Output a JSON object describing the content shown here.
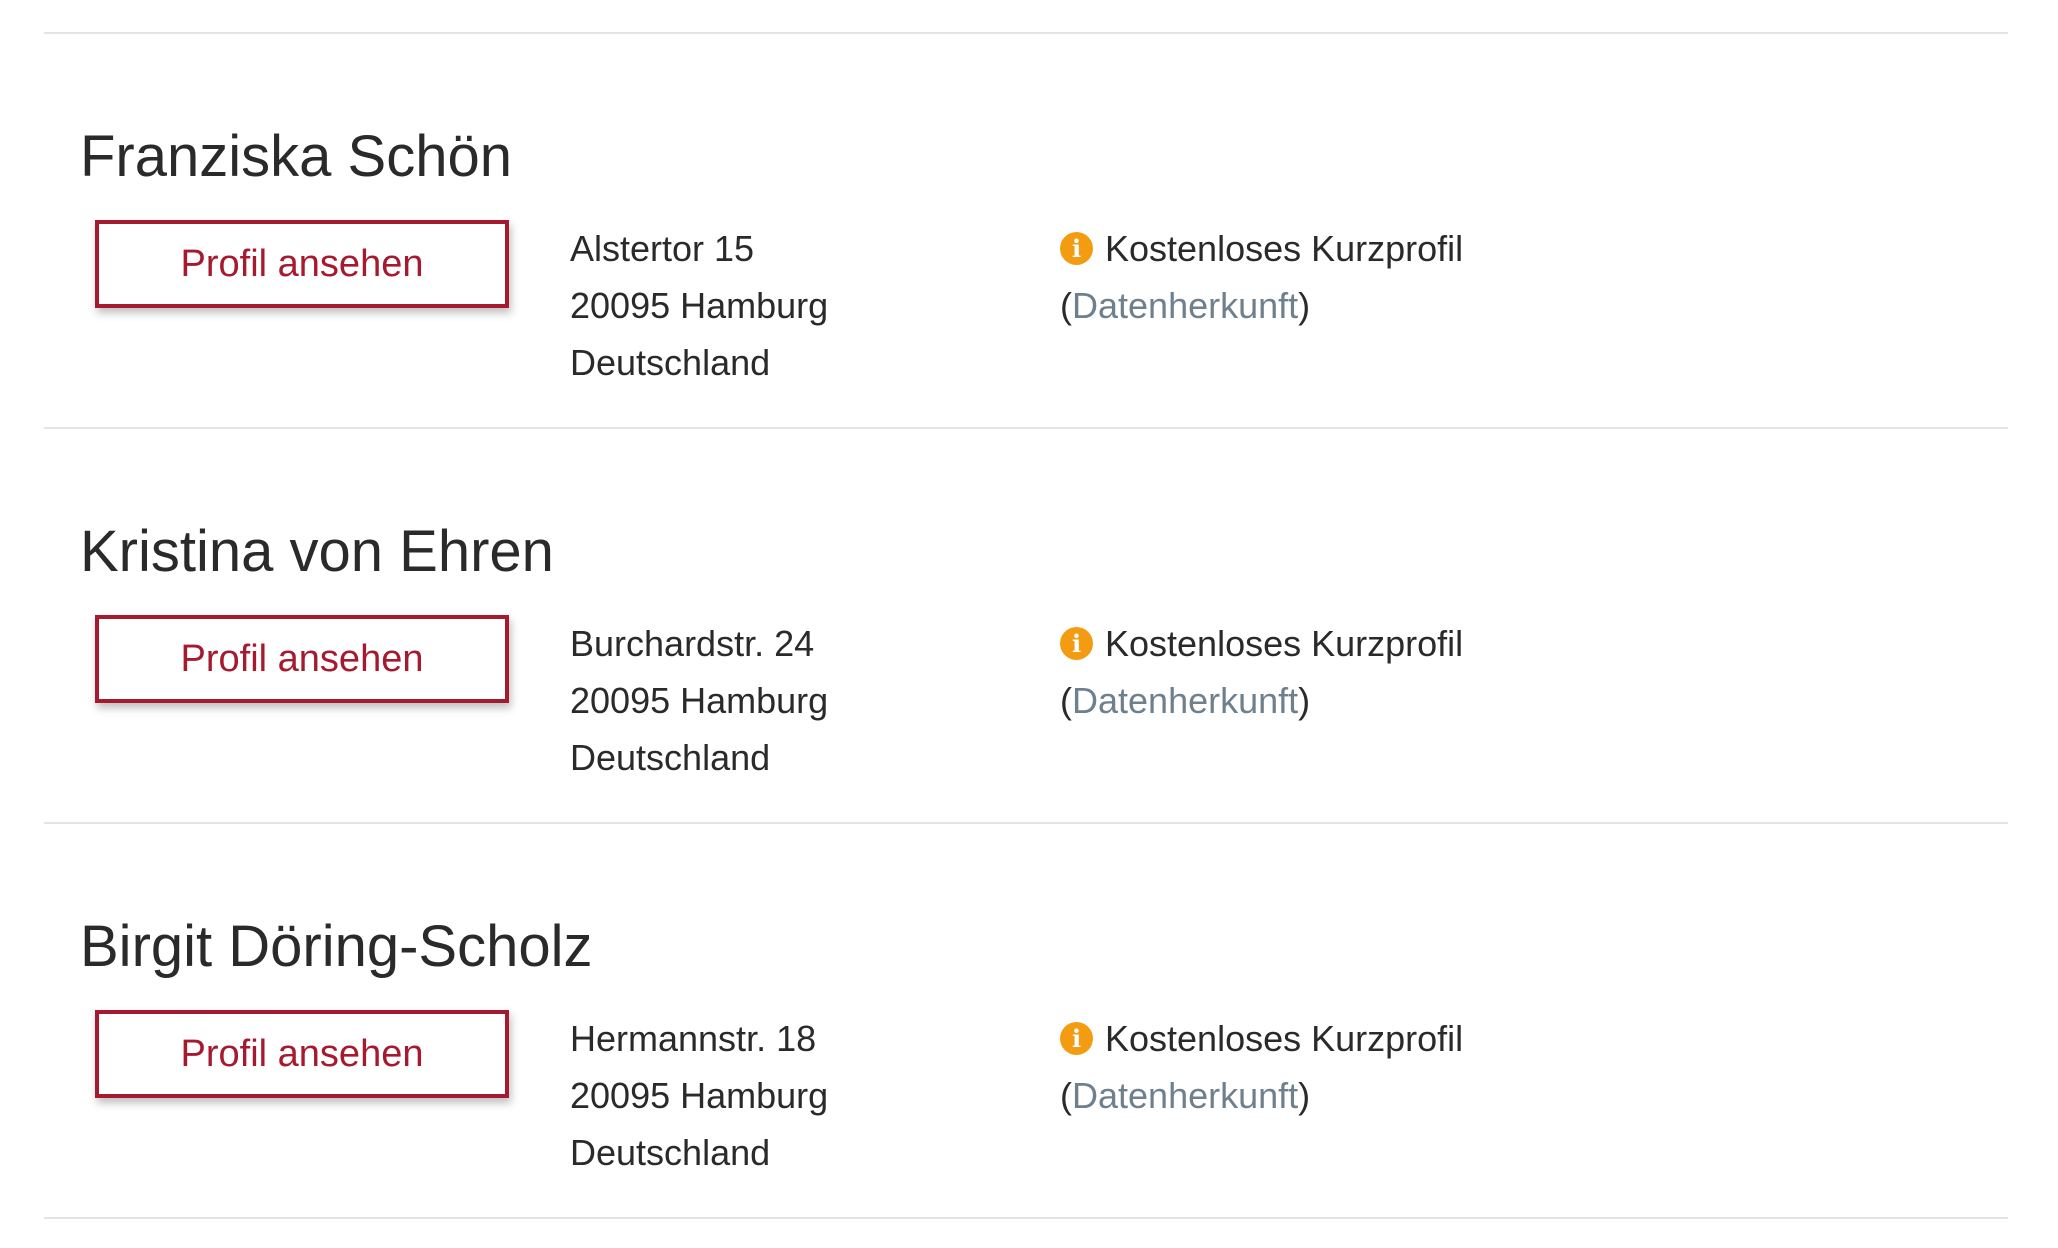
{
  "entries": [
    {
      "name": "Franziska Schön",
      "button_label": "Profil ansehen",
      "address": [
        "Alstertor 15",
        "20095 Hamburg",
        "Deutschland"
      ],
      "profile_type": "Kostenloses Kurzprofil",
      "source_link": "Datenherkunft",
      "paren_open": "(",
      "paren_close": ")"
    },
    {
      "name": "Kristina von Ehren",
      "button_label": "Profil ansehen",
      "address": [
        "Burchardstr. 24",
        "20095 Hamburg",
        "Deutschland"
      ],
      "profile_type": "Kostenloses Kurzprofil",
      "source_link": "Datenherkunft",
      "paren_open": "(",
      "paren_close": ")"
    },
    {
      "name": "Birgit Döring-Scholz",
      "button_label": "Profil ansehen",
      "address": [
        "Hermannstr. 18",
        "20095 Hamburg",
        "Deutschland"
      ],
      "profile_type": "Kostenloses Kurzprofil",
      "source_link": "Datenherkunft",
      "paren_open": "(",
      "paren_close": ")"
    }
  ],
  "icons": {
    "info": "info-icon",
    "info_glyph": "i"
  },
  "colors": {
    "accent": "#a51a2e",
    "info_icon": "#f39c12",
    "link": "#6e7f8d",
    "divider": "#e4e4e4"
  }
}
